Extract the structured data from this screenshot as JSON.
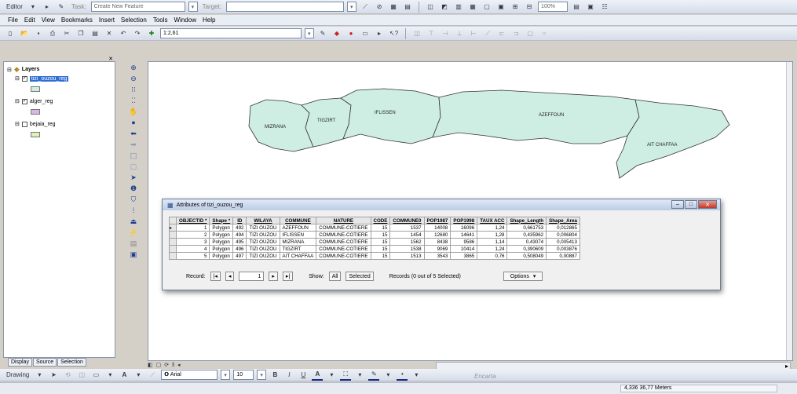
{
  "editor_bar": {
    "editor_label": "Editor",
    "task_label": "Task:",
    "task_value": "Create New Feature",
    "target_label": "Target:",
    "zoom_value": "100%"
  },
  "menu": [
    "File",
    "Edit",
    "View",
    "Bookmarks",
    "Insert",
    "Selection",
    "Tools",
    "Window",
    "Help"
  ],
  "standard_bar": {
    "scale_value": "1:2,61"
  },
  "toc": {
    "root_label": "Layers",
    "layers": [
      {
        "name": "tizi_ouzou_reg",
        "checked": true,
        "selected": true,
        "color": "#cfeee3"
      },
      {
        "name": "alger_reg",
        "checked": true,
        "selected": false,
        "color": "#d8b6e6"
      },
      {
        "name": "bejaia_reg",
        "checked": false,
        "selected": false,
        "color": "#dff0b8"
      }
    ],
    "tabs": [
      "Display",
      "Source",
      "Selection"
    ]
  },
  "map": {
    "fill_color": "#cfeee3",
    "communes": [
      "MIZRANA",
      "TIGZIRT",
      "IFLISSEN",
      "AZEFFOUN",
      "AIT CHAFFAA"
    ]
  },
  "attribute_window": {
    "title": "Attributes of tizi_ouzou_reg",
    "columns": [
      "OBJECTID *",
      "Shape *",
      "ID",
      "WILAYA",
      "COMMUNE",
      "NATURE",
      "CODE",
      "COMMUNE0",
      "POP1987",
      "POP1998",
      "TAUX ACC",
      "Shape_Length",
      "Shape_Area"
    ],
    "rows": [
      [
        "1",
        "Polygon",
        "492",
        "TIZI OUZOU",
        "AZEFFOUN",
        "COMMUNE-COTIERE",
        "15",
        "1537",
        "14008",
        "16096",
        "1,24",
        "0,661753",
        "0,012865"
      ],
      [
        "2",
        "Polygon",
        "494",
        "TIZI OUZOU",
        "IFLISSEN",
        "COMMUNE-COTIERE",
        "15",
        "1454",
        "12680",
        "14641",
        "1,28",
        "0,435962",
        "0,006804"
      ],
      [
        "3",
        "Polygon",
        "495",
        "TIZI OUZOU",
        "MIZRANA",
        "COMMUNE-COTIERE",
        "15",
        "1562",
        "8438",
        "9586",
        "1,14",
        "0,43074",
        "0,005413"
      ],
      [
        "4",
        "Polygon",
        "496",
        "TIZI OUZOU",
        "TIGZIRT",
        "COMMUNE-COTIERE",
        "15",
        "1538",
        "9069",
        "10414",
        "1,24",
        "0,390609",
        "0,003876"
      ],
      [
        "5",
        "Polygon",
        "497",
        "TIZI OUZOU",
        "AIT CHAFFAA",
        "COMMUNE-COTIERE",
        "15",
        "1513",
        "3543",
        "3865",
        "0,76",
        "0,508049",
        "0,00887"
      ]
    ],
    "record_label": "Record:",
    "record_value": "1",
    "show_label": "Show:",
    "show_all": "All",
    "show_selected": "Selected",
    "records_text": "Records (0 out of 5 Selected)",
    "options_label": "Options"
  },
  "drawing_bar": {
    "drawing_label": "Drawing",
    "font_value": "Arial",
    "size_value": "10"
  },
  "status": {
    "watermark": "Encarta",
    "coords": "4,336  36,77 Meters"
  }
}
